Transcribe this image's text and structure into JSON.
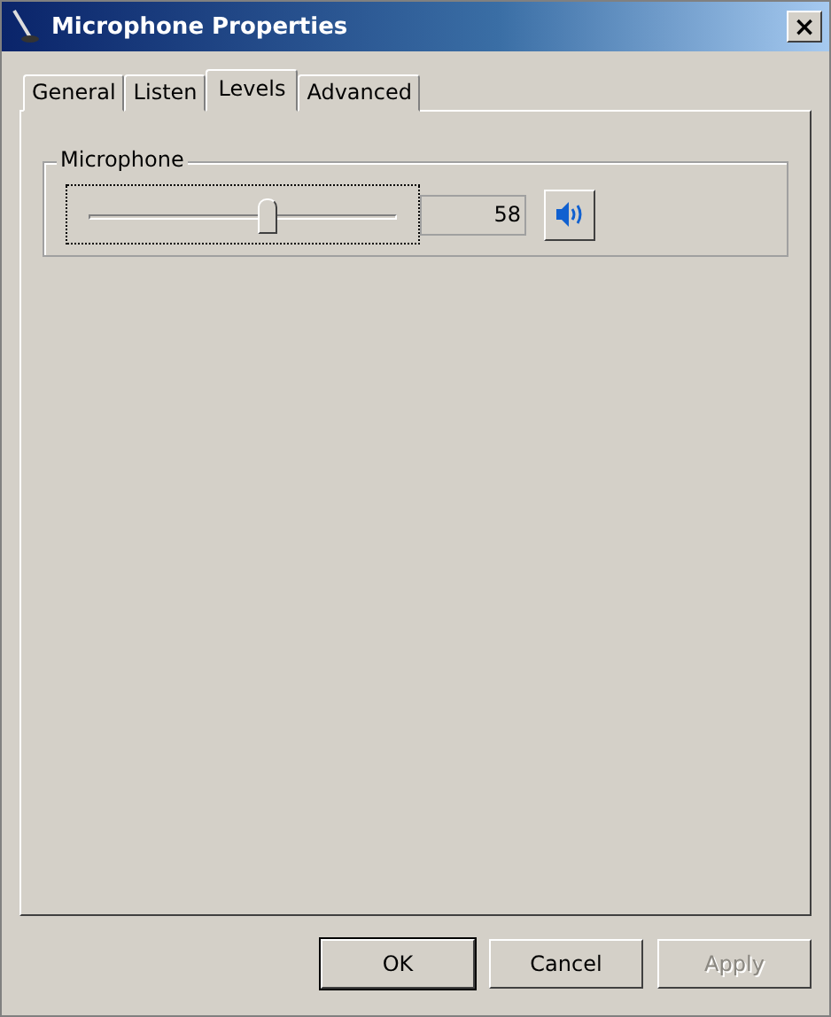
{
  "window": {
    "title": "Microphone Properties",
    "close": "×"
  },
  "tabs": [
    {
      "label": "General",
      "selected": false
    },
    {
      "label": "Listen",
      "selected": false
    },
    {
      "label": "Levels",
      "selected": true
    },
    {
      "label": "Advanced",
      "selected": false
    }
  ],
  "group": {
    "title": "Microphone",
    "slider": {
      "level": 0.58
    },
    "reading": "58",
    "muted": false
  },
  "buttons": [
    {
      "label": "OK",
      "default": true,
      "disabled": false
    },
    {
      "label": "Cancel",
      "default": false,
      "disabled": false
    },
    {
      "label": "Apply",
      "default": false,
      "disabled": true
    }
  ]
}
